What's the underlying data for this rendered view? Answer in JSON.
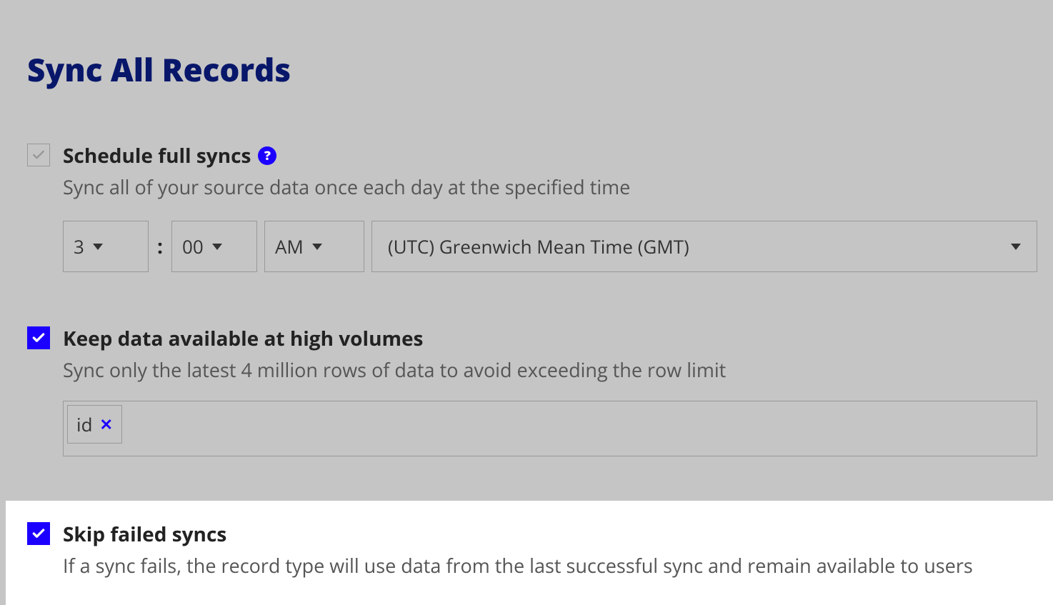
{
  "page": {
    "title": "Sync All Records"
  },
  "schedule": {
    "label": "Schedule full syncs",
    "help_icon": "?",
    "desc": "Sync all of your source data once each day at the specified time",
    "hour": "3",
    "minute": "00",
    "period": "AM",
    "timezone": "(UTC) Greenwich Mean Time (GMT)"
  },
  "keep_data": {
    "label": "Keep data available at high volumes",
    "desc": "Sync only the latest 4 million rows of data to avoid exceeding the row limit",
    "tags": [
      "id"
    ]
  },
  "skip_failed": {
    "label": "Skip failed syncs",
    "desc": "If a sync fails, the record type will use data from the last successful sync and remain available to users"
  }
}
